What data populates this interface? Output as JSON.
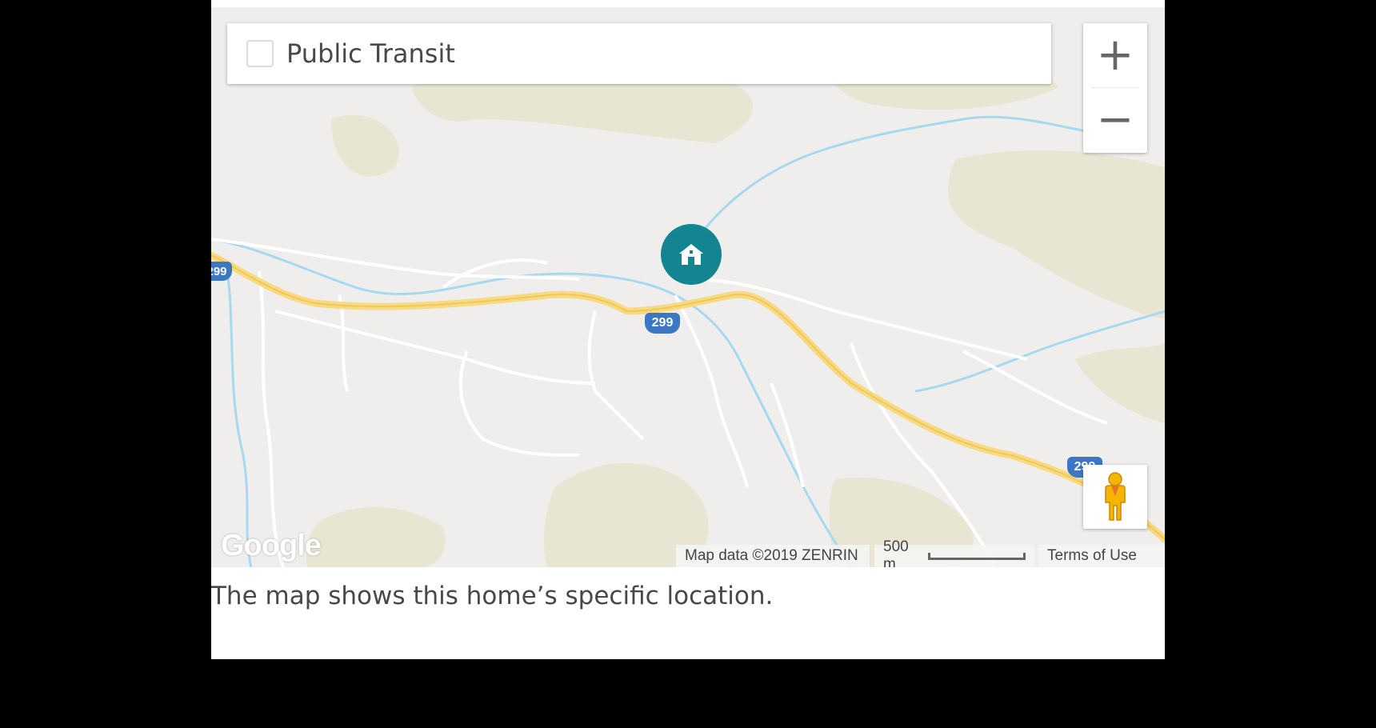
{
  "map": {
    "transit_label": "Public Transit",
    "transit_checked": false,
    "zoom_in_label": "+",
    "zoom_out_label": "−",
    "route_shields": [
      "299",
      "299",
      "299"
    ],
    "google_logo": "Google",
    "map_data": "Map data ©2019 ZENRIN",
    "scale_label": "500 m",
    "terms_label": "Terms of Use"
  },
  "caption": "The map shows this home’s specific location.",
  "colors": {
    "land": "#efeeec",
    "park": "#e8e6d3",
    "highway": "#f7da84",
    "water": "#a6d9f0",
    "shield": "#3b77c3",
    "marker": "#128590",
    "pegman": "#f4b400"
  }
}
